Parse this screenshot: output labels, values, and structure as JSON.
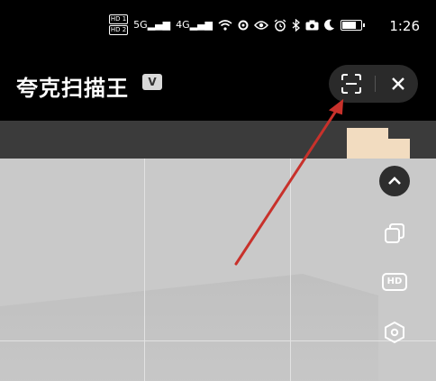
{
  "status_bar": {
    "hd1": "HD 1",
    "hd2": "HD 2",
    "net1": "5G",
    "net2": "4G",
    "time": "1:26"
  },
  "header": {
    "title": "夸克扫描王",
    "badge": "V"
  },
  "side_tools": {
    "hd_label": "HD"
  },
  "colors": {
    "accent_arrow": "#c8312b",
    "header_bg": "#000000",
    "capsule_bg": "#2a2a2a"
  }
}
